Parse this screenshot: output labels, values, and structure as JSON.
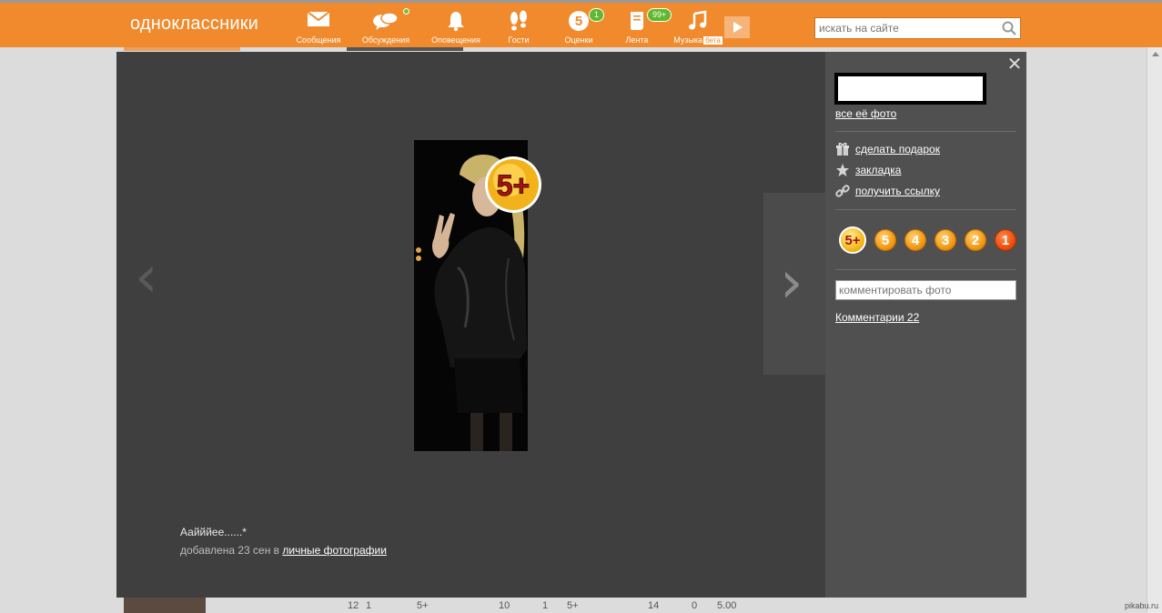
{
  "header": {
    "logo": "одноклассники",
    "nav": [
      {
        "label": "Сообщения",
        "icon": "envelope-icon"
      },
      {
        "label": "Обсуждения",
        "icon": "chat-bubbles-icon"
      },
      {
        "label": "Оповещения",
        "icon": "bell-icon"
      },
      {
        "label": "Гости",
        "icon": "footprints-icon"
      },
      {
        "label": "Оценки",
        "icon": "rating-five-icon",
        "glyph": "5",
        "badge": "1"
      },
      {
        "label": "Лента",
        "icon": "feed-icon",
        "badge": "99+"
      },
      {
        "label": "Музыка",
        "icon": "music-note-icon",
        "tag": "бета"
      }
    ],
    "search_placeholder": "искать на сайте"
  },
  "viewer": {
    "prev_glyph": "‹",
    "next_glyph": "›",
    "close_glyph": "✕",
    "rating_badge": "5+",
    "caption": "Аайййее......*",
    "added_text": "добавлена 23 сен в",
    "album_link": "личные фотографии"
  },
  "sidebar": {
    "all_photos": "все её фото",
    "actions": [
      {
        "label": "сделать подарок",
        "icon": "gift-icon"
      },
      {
        "label": "закладка",
        "icon": "star-icon"
      },
      {
        "label": "получить ссылку",
        "icon": "link-icon"
      }
    ],
    "ratings": [
      "5+",
      "5",
      "4",
      "3",
      "2",
      "1"
    ],
    "comment_placeholder": "комментировать фото",
    "comments_link": "Комментарии 22"
  },
  "background": {
    "stats": [
      "12",
      "1",
      "5+",
      "10",
      "1",
      "5+",
      "14",
      "0",
      "5.00"
    ],
    "watermark": "pikabu.ru"
  },
  "colors": {
    "brand": "#f08a2c",
    "viewer_bg": "#3f3f3f",
    "sidebar_bg": "#505050"
  }
}
